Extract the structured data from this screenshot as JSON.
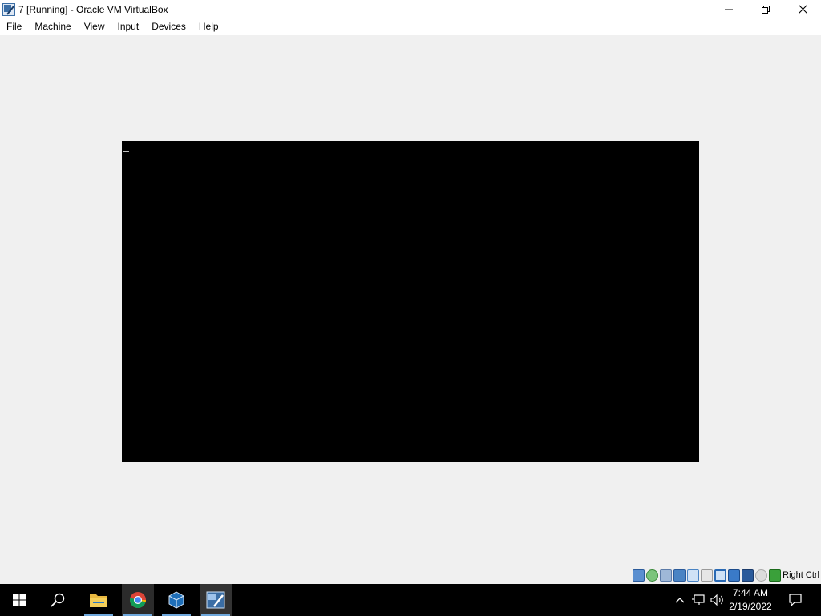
{
  "window": {
    "title": "7 [Running] - Oracle VM VirtualBox",
    "controls": [
      "minimize-icon",
      "restore-icon",
      "close-icon"
    ]
  },
  "menu": [
    "File",
    "Machine",
    "View",
    "Input",
    "Devices",
    "Help"
  ],
  "statusbar": {
    "icons": [
      "hard-disk-icon",
      "optical-drive-icon",
      "audio-icon",
      "network-icon",
      "usb-icon",
      "shared-folders-icon",
      "display-icon",
      "video-capture-icon",
      "virtualization-icon",
      "mouse-integration-icon",
      "keyboard-icon"
    ],
    "host_key": "Right Ctrl"
  },
  "taskbar": {
    "apps": [
      "start-icon",
      "search-icon",
      "file-explorer-icon",
      "chrome-icon",
      "virtualbox-icon",
      "vm-window-icon"
    ],
    "time": "7:44 AM",
    "date": "2/19/2022",
    "tray": [
      "chevron-up-icon",
      "network-icon",
      "volume-icon",
      "notification-icon"
    ]
  }
}
